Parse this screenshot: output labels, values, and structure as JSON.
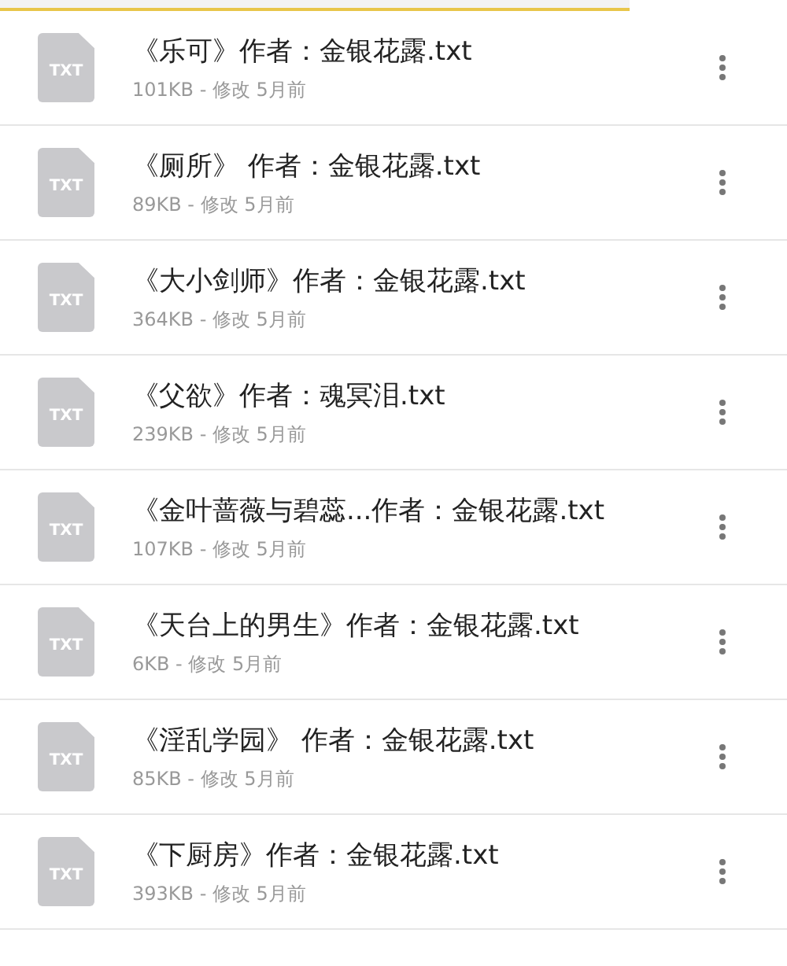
{
  "files": [
    {
      "icon_label": "TXT",
      "name": "《乐可》作者：金银花露.txt",
      "meta": "101KB - 修改 5月前"
    },
    {
      "icon_label": "TXT",
      "name": "《厕所》 作者：金银花露.txt",
      "meta": "89KB - 修改 5月前"
    },
    {
      "icon_label": "TXT",
      "name": "《大小剑师》作者：金银花露.txt",
      "meta": "364KB - 修改 5月前"
    },
    {
      "icon_label": "TXT",
      "name": "《父欲》作者：魂冥泪.txt",
      "meta": "239KB - 修改 5月前"
    },
    {
      "icon_label": "TXT",
      "name": "《金叶蔷薇与碧蕊...作者：金银花露.txt",
      "meta": "107KB - 修改 5月前"
    },
    {
      "icon_label": "TXT",
      "name": "《天台上的男生》作者：金银花露.txt",
      "meta": "6KB - 修改 5月前"
    },
    {
      "icon_label": "TXT",
      "name": "《淫乱学园》 作者：金银花露.txt",
      "meta": "85KB - 修改 5月前"
    },
    {
      "icon_label": "TXT",
      "name": "《下厨房》作者：金银花露.txt",
      "meta": "393KB - 修改 5月前"
    }
  ]
}
